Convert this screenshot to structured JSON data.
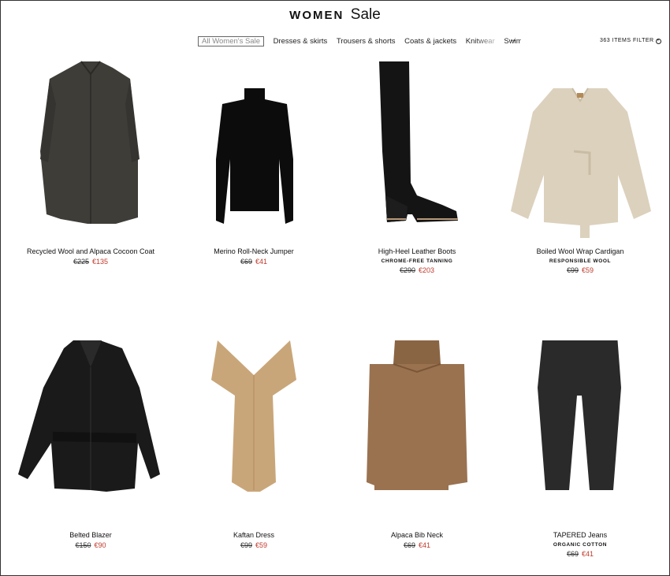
{
  "header": {
    "title_a": "WOMEN",
    "title_b": "Sale",
    "categories": [
      "All Women's Sale",
      "Dresses & skirts",
      "Trousers & shorts",
      "Coats & jackets",
      "Knitwear",
      "Swimwear"
    ],
    "next_arrow": "→",
    "items_count": "363 ITEMS",
    "filter_label": "FILTER"
  },
  "products": [
    {
      "name": "Recycled Wool and Alpaca Cocoon Coat",
      "sub": "",
      "old_price": "€225",
      "new_price": "€135",
      "icon": "coat-image"
    },
    {
      "name": "Merino Roll-Neck Jumper",
      "sub": "",
      "old_price": "€69",
      "new_price": "€41",
      "icon": "jumper-image"
    },
    {
      "name": "High-Heel Leather Boots",
      "sub": "CHROME-FREE TANNING",
      "old_price": "€290",
      "new_price": "€203",
      "icon": "boots-image"
    },
    {
      "name": "Boiled Wool Wrap Cardigan",
      "sub": "RESPONSIBLE WOOL",
      "old_price": "€99",
      "new_price": "€59",
      "icon": "cardigan-image"
    },
    {
      "name": "Belted Blazer",
      "sub": "",
      "old_price": "€150",
      "new_price": "€90",
      "icon": "blazer-image"
    },
    {
      "name": "Kaftan Dress",
      "sub": "",
      "old_price": "€99",
      "new_price": "€59",
      "icon": "dress-image"
    },
    {
      "name": "Alpaca Bib Neck",
      "sub": "",
      "old_price": "€69",
      "new_price": "€41",
      "icon": "bib-neck-image"
    },
    {
      "name": "TAPERED Jeans",
      "sub": "ORGANIC COTTON",
      "old_price": "€69",
      "new_price": "€41",
      "icon": "jeans-image"
    }
  ]
}
